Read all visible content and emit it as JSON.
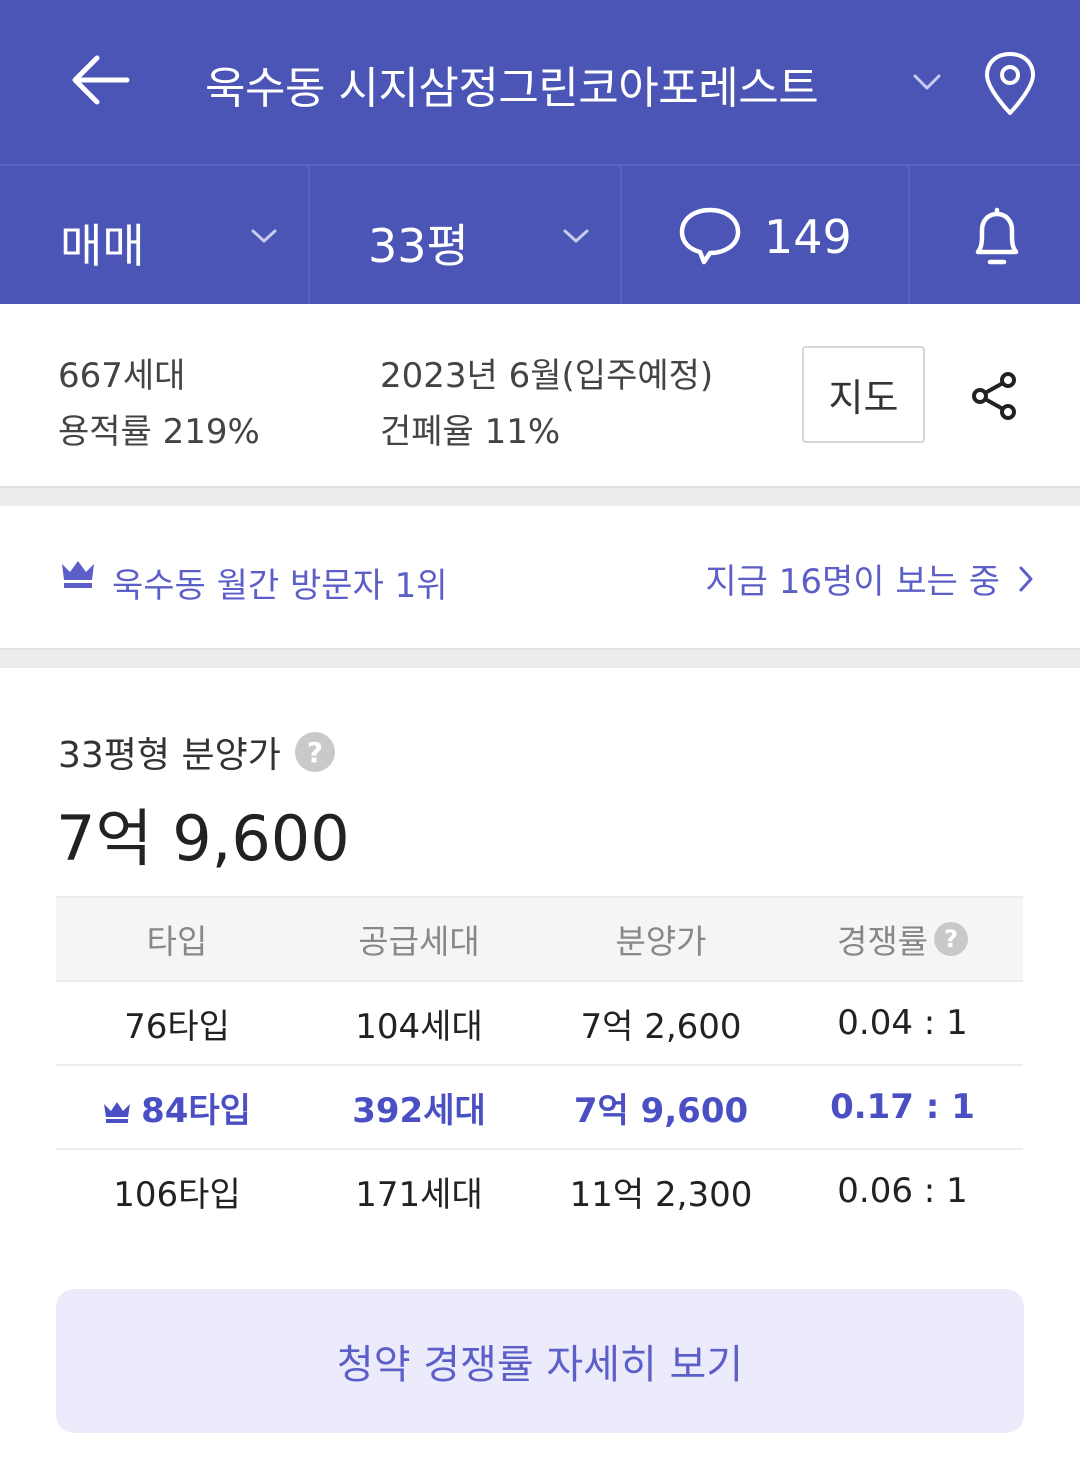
{
  "header": {
    "title": "욱수동 시지삼정그린코아포레스트"
  },
  "filters": {
    "deal_type": "매매",
    "size": "33평",
    "comment_count": "149"
  },
  "info": {
    "households": "667세대",
    "floor_area_ratio": "용적률 219%",
    "move_in": "2023년 6월(입주예정)",
    "building_coverage": "건폐율 11%",
    "map_label": "지도"
  },
  "rank": {
    "text": "욱수동 월간 방문자 1위",
    "now_viewing": "지금 16명이 보는 중"
  },
  "presale": {
    "label": "33평형 분양가",
    "price": "7억 9,600",
    "help": "?"
  },
  "table": {
    "headers": [
      "타입",
      "공급세대",
      "분양가",
      "경쟁률"
    ],
    "rows": [
      {
        "type": "76타입",
        "supply": "104세대",
        "price": "7억 2,600",
        "ratio": "0.04 : 1"
      },
      {
        "type": "84타입",
        "supply": "392세대",
        "price": "7억 9,600",
        "ratio": "0.17 : 1"
      },
      {
        "type": "106타입",
        "supply": "171세대",
        "price": "11억 2,300",
        "ratio": "0.06 : 1"
      }
    ]
  },
  "detail_button": "청약 경쟁률 자세히 보기",
  "colors": {
    "brand": "#4b55b6",
    "accent": "#5b5fc7",
    "highlight": "#4a4fc3"
  },
  "icons": [
    "back-arrow-icon",
    "chevron-down-icon",
    "location-pin-icon",
    "speech-bubble-icon",
    "bell-icon",
    "share-icon",
    "crown-icon",
    "chevron-right-icon",
    "help-icon"
  ]
}
